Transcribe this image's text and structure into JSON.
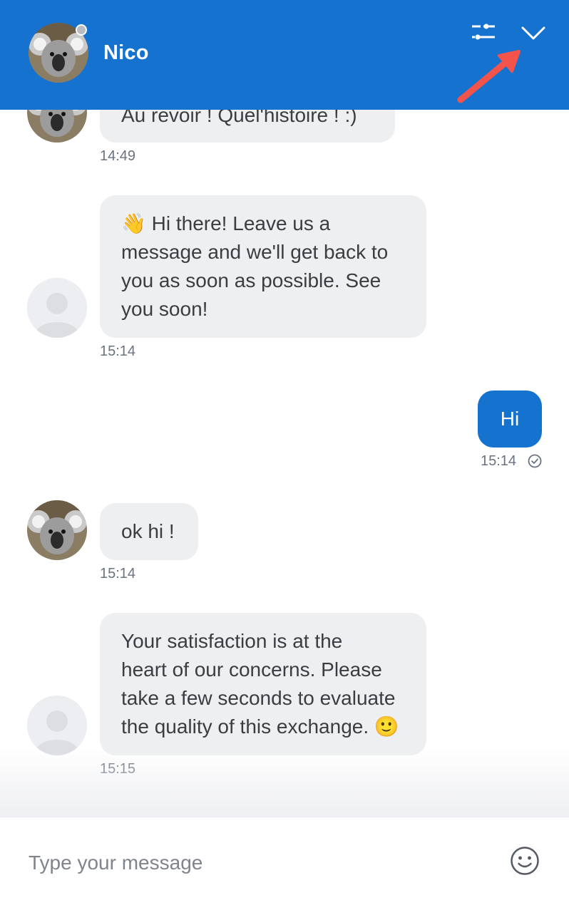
{
  "header": {
    "agent_name": "Nico",
    "status_color": "#b9bcc1",
    "accent_color": "#1672cf",
    "icons": {
      "settings": "sliders-icon",
      "collapse": "chevron-down-icon"
    }
  },
  "messages": [
    {
      "sender": "agent",
      "text": "Au revoir ! Quel'histoire ! :)",
      "time": "14:49"
    },
    {
      "sender": "bot",
      "text": "👋 Hi there! Leave us a\nmessage and we'll get back to\nyou as soon as possible. See\nyou soon!",
      "time": "15:14"
    },
    {
      "sender": "user",
      "text": "Hi",
      "time": "15:14",
      "status_icon": "check-circle-icon"
    },
    {
      "sender": "agent",
      "text": "ok hi !",
      "time": "15:14"
    },
    {
      "sender": "bot",
      "text": "Your satisfaction is at the\nheart of our concerns. Please\ntake a few seconds to evaluate\nthe quality of this exchange. 🙂",
      "time": "15:15"
    }
  ],
  "composer": {
    "placeholder": "Type your message",
    "value": "",
    "emoji_icon": "smiley-icon"
  }
}
